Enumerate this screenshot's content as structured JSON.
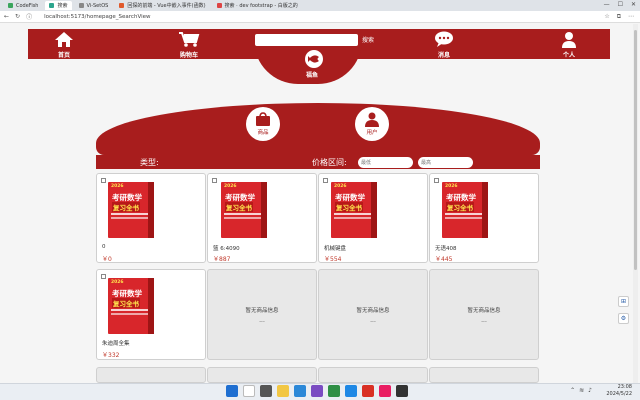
{
  "browser": {
    "tabs": [
      {
        "label": "CodeFish",
        "active": false,
        "color": "#3aa55d"
      },
      {
        "label": "搜索",
        "active": true,
        "color": "#2ca58d"
      },
      {
        "label": "Vi-SetOS",
        "active": false,
        "color": "#6b6b6b"
      },
      {
        "label": "回探的前端 - Vue中嵌入事件(函数)",
        "active": false,
        "color": "#e0592b"
      },
      {
        "label": "搜索 · dev footstrap - 白版之的",
        "active": false,
        "color": "#d44"
      }
    ],
    "url": "localhost:5173/homepage_SearchView"
  },
  "header": {
    "nav": [
      {
        "label": "首页",
        "icon": "home-icon"
      },
      {
        "label": "购物车",
        "icon": "cart-icon"
      },
      {
        "label": "消息",
        "icon": "chat-icon"
      },
      {
        "label": "个人",
        "icon": "user-icon"
      }
    ],
    "search_placeholder": "",
    "search_button": "搜索",
    "logo_text": "福鱼"
  },
  "categories": [
    {
      "label": "商品",
      "icon": "shopping-bag-icon"
    },
    {
      "label": "用户",
      "icon": "user-icon"
    }
  ],
  "filter": {
    "type_label": "类型:",
    "price_label": "价格区间:",
    "min_placeholder": "最低",
    "max_placeholder": "最高"
  },
  "book_cover": {
    "top": "2026",
    "title1": "考研数学",
    "title2": "复习全书"
  },
  "products": [
    {
      "name": "0",
      "price": "￥0"
    },
    {
      "name": "篮 6:4090",
      "price": "￥887"
    },
    {
      "name": "机械键盘",
      "price": "￥554"
    },
    {
      "name": "无语408",
      "price": "￥445"
    },
    {
      "name": "朱迪周全集",
      "price": "￥332"
    }
  ],
  "empty_card": {
    "text": "暂无商品信息",
    "dots": "..."
  },
  "taskbar": {
    "time": "23:08",
    "date": "2024/5/22"
  },
  "colors": {
    "brand_red": "#a81d1d",
    "price_red": "#c0392b"
  }
}
